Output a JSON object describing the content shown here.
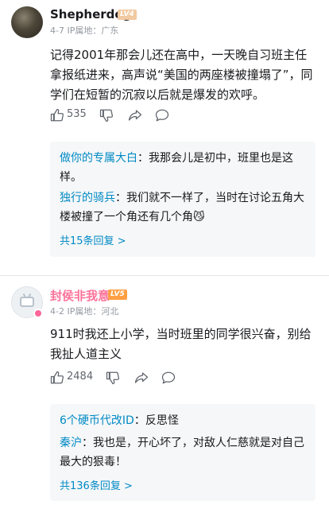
{
  "comments": [
    {
      "username": "Shepherdog",
      "level": "LV4",
      "meta": "4-7  IP属地：广东",
      "text": "记得2001年那会儿还在高中，一天晚自习班主任拿报纸进来，高声说“美国的两座楼被撞塌了”，同学们在短暂的沉寂以后就是爆发的欢呼。",
      "likes": "535",
      "replies": [
        {
          "name": "做你的专属大白",
          "text": "：我那会儿是初中，班里也是这样。"
        },
        {
          "name": "独行的骑兵",
          "text": "：我们就不一样了，当时在讨论五角大楼被撞了一个角还有几个角"
        }
      ],
      "reply_emoji": "😼",
      "more_replies": "共15条回复 >"
    },
    {
      "username": "封侯非我意",
      "level": "LV5",
      "meta": "4-2  IP属地：河北",
      "text": "911时我还上小学，当时班里的同学很兴奋，别给我扯人道主义",
      "likes": "2484",
      "replies": [
        {
          "name": "6个硬币代改ID",
          "text": "：反思怪"
        },
        {
          "name": "秦沪",
          "text": "：我也是，开心坏了，对敌人仁慈就是对自己最大的狠毒！"
        }
      ],
      "more_replies": "共136条回复 >"
    }
  ],
  "icons": [
    "like-icon",
    "dislike-icon",
    "share-icon",
    "comment-icon"
  ],
  "colors": {
    "accent": "#008ac5",
    "vip_name": "#fb7299"
  }
}
